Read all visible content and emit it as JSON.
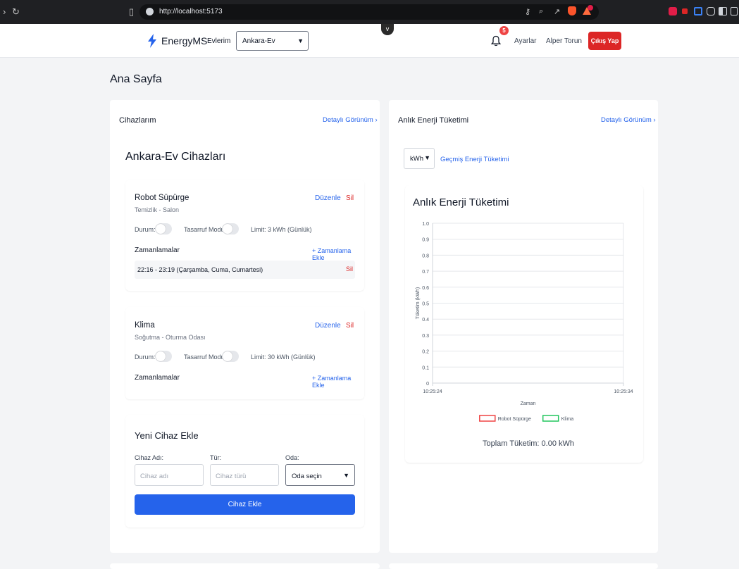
{
  "browser": {
    "url": "http://localhost:5173"
  },
  "header": {
    "brand": "EnergyMS",
    "nav_homes": "Evlerim",
    "home_select": "Ankara-Ev",
    "notification_count": "5",
    "settings": "Ayarlar",
    "user_name": "Alper Torun",
    "logout": "Çıkış Yap"
  },
  "page": {
    "title": "Ana Sayfa"
  },
  "devices_panel": {
    "title": "Cihazlarım",
    "detail_link": "Detaylı Görünüm",
    "section_title": "Ankara-Ev Cihazları",
    "devices": [
      {
        "name": "Robot Süpürge",
        "subtitle": "Temizlik - Salon",
        "edit": "Düzenle",
        "delete": "Sil",
        "status_label": "Durum:",
        "status_on": false,
        "saving_label": "Tasarruf Modu:",
        "saving_on": false,
        "limit": "Limit: 3 kWh (Günlük)",
        "schedules_label": "Zamanlamalar",
        "add_schedule": "+ Zamanlama Ekle",
        "schedules": [
          {
            "text": "22:16 - 23:19 (Çarşamba, Cuma, Cumartesi)",
            "delete": "Sil"
          }
        ]
      },
      {
        "name": "Klima",
        "subtitle": "Soğutma - Oturma Odası",
        "edit": "Düzenle",
        "delete": "Sil",
        "status_label": "Durum:",
        "status_on": false,
        "saving_label": "Tasarruf Modu:",
        "saving_on": false,
        "limit": "Limit: 30 kWh (Günlük)",
        "schedules_label": "Zamanlamalar",
        "add_schedule": "+ Zamanlama Ekle",
        "schedules": []
      }
    ],
    "new_device": {
      "title": "Yeni Cihaz Ekle",
      "name_label": "Cihaz Adı:",
      "name_placeholder": "Cihaz adı",
      "type_label": "Tür:",
      "type_placeholder": "Cihaz türü",
      "room_label": "Oda:",
      "room_select": "Oda seçin",
      "submit": "Cihaz Ekle"
    }
  },
  "energy_panel": {
    "title": "Anlık Enerji Tüketimi",
    "detail_link": "Detaylı Görünüm",
    "unit_select": "kWh",
    "history_link": "Geçmiş Enerji Tüketimi",
    "chart_title": "Anlık Enerji Tüketimi",
    "total": "Toplam Tüketim: 0.00 kWh"
  },
  "colors": {
    "primary": "#2563eb",
    "danger": "#dc2626",
    "series_robot": "#ef4444",
    "series_klima": "#22c55e"
  },
  "chart_data": {
    "type": "line",
    "title": "",
    "xlabel": "Zaman",
    "ylabel": "Tüketim (kWh)",
    "x": [
      "10:25:24",
      "10:25:34"
    ],
    "ylim": [
      0,
      1.0
    ],
    "yticks": [
      "0",
      "0.1",
      "0.2",
      "0.3",
      "0.4",
      "0.5",
      "0.6",
      "0.7",
      "0.8",
      "0.9",
      "1.0"
    ],
    "grid": true,
    "legend_position": "bottom",
    "series": [
      {
        "name": "Robot Süpürge",
        "color": "#ef4444",
        "values": []
      },
      {
        "name": "Klima",
        "color": "#22c55e",
        "values": []
      }
    ]
  }
}
